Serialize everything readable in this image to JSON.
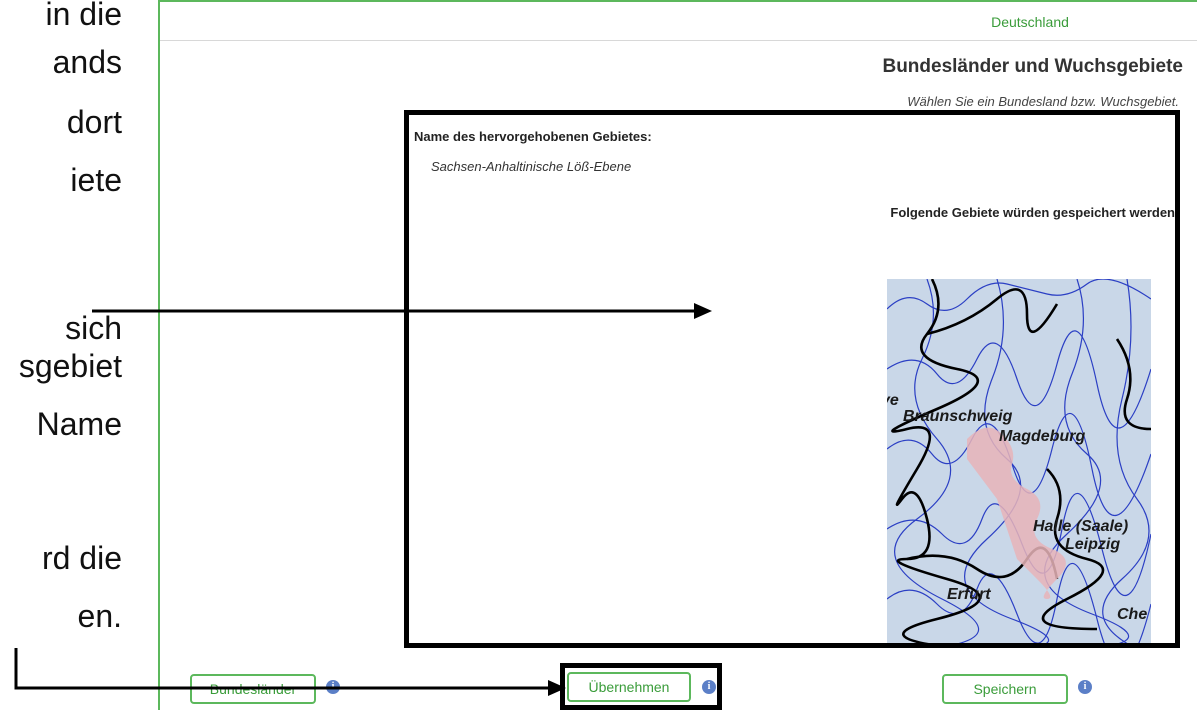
{
  "side_text": [
    "in die",
    "ands",
    "dort",
    "iete",
    "sich",
    "sgebiet",
    "Name",
    "rd die",
    "en."
  ],
  "tab": {
    "label": "Deutschland"
  },
  "header": {
    "title": "Bundesländer und Wuchsgebiete",
    "subtitle": "Wählen Sie ein Bundesland bzw. Wuchsgebiet."
  },
  "highlight": {
    "label": "Name des hervorgehobenen Gebietes:",
    "value": "Sachsen-Anhaltinische Löß-Ebene"
  },
  "save_hint": "Folgende Gebiete würden gespeichert werden",
  "map": {
    "cities": [
      "Braunschweig",
      "Magdeburg",
      "Halle (Saale)",
      "Leipzig",
      "Erfurt",
      "Che",
      "ve"
    ]
  },
  "buttons": {
    "bundeslaender": "Bundesländer",
    "uebernehmen": "Übernehmen",
    "speichern": "Speichern",
    "info_glyph": "i"
  },
  "colors": {
    "accent": "#5cb85c",
    "info": "#5b7fc7",
    "map_bg": "#c9d7e8",
    "region_highlight": "#e8b4b8"
  }
}
